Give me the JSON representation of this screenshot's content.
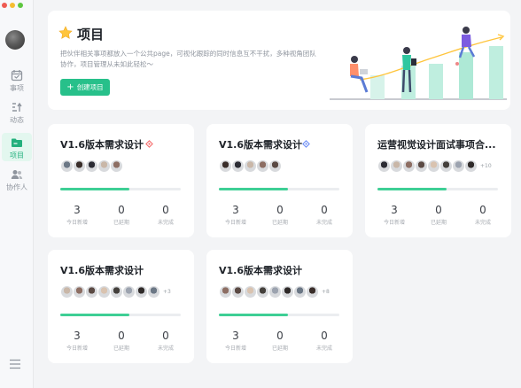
{
  "sidebar": {
    "nav": [
      {
        "label": "事项",
        "icon": "calendar-icon"
      },
      {
        "label": "动态",
        "icon": "activity-icon"
      },
      {
        "label": "项目",
        "icon": "folder-icon",
        "active": true
      },
      {
        "label": "协作人",
        "icon": "collaborator-icon"
      }
    ]
  },
  "banner": {
    "title": "项目",
    "description": "把伙伴相关事项都放入一个公共page，可视化跟踪的同时信息互不干扰，多种视角团队协作，项目管理从未如此轻松～",
    "create_button": "创建项目"
  },
  "colors": {
    "accent": "#27c08a",
    "progress": "#3ecf95"
  },
  "cards": [
    {
      "title": "V1.6版本需求设计",
      "tag": "red",
      "members": 5,
      "more": "",
      "progress": 0.57,
      "stats": [
        {
          "n": "3",
          "l": "今日新增"
        },
        {
          "n": "0",
          "l": "已延期"
        },
        {
          "n": "0",
          "l": "未完成"
        }
      ]
    },
    {
      "title": "V1.6版本需求设计",
      "tag": "blue",
      "members": 5,
      "more": "",
      "progress": 0.57,
      "stats": [
        {
          "n": "3",
          "l": "今日新增"
        },
        {
          "n": "0",
          "l": "已延期"
        },
        {
          "n": "0",
          "l": "未完成"
        }
      ]
    },
    {
      "title": "运营视觉设计面试事项合...",
      "tag": "",
      "members": 8,
      "more": "+10",
      "progress": 0.57,
      "stats": [
        {
          "n": "3",
          "l": "今日新增"
        },
        {
          "n": "0",
          "l": "已延期"
        },
        {
          "n": "0",
          "l": "未完成"
        }
      ]
    },
    {
      "title": "V1.6版本需求设计",
      "tag": "",
      "members": 8,
      "more": "+3",
      "progress": 0.57,
      "stats": [
        {
          "n": "3",
          "l": "今日新增"
        },
        {
          "n": "0",
          "l": "已延期"
        },
        {
          "n": "0",
          "l": "未完成"
        }
      ]
    },
    {
      "title": "V1.6版本需求设计",
      "tag": "",
      "members": 8,
      "more": "+8",
      "progress": 0.57,
      "stats": [
        {
          "n": "3",
          "l": "今日新增"
        },
        {
          "n": "0",
          "l": "已延期"
        },
        {
          "n": "0",
          "l": "未完成"
        }
      ]
    }
  ]
}
